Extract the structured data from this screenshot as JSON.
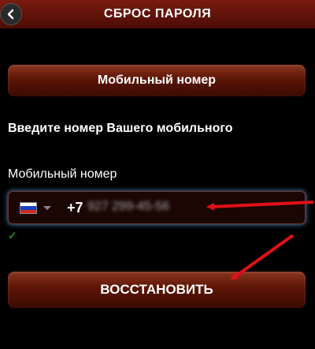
{
  "header": {
    "title": "СБРОС ПАРОЛЯ",
    "back_icon": "chevron-left-icon",
    "background": "#6a150c"
  },
  "tab": {
    "label": "Мобильный номер"
  },
  "form": {
    "heading": "Введите номер Вашего мобильного",
    "field_label": "Мобильный номер",
    "country_icon": "russia-flag-icon",
    "prefix": "+7",
    "phone_value": "927 299-45-56",
    "validation_icon": "checkmark-icon",
    "validation_glyph": "✓",
    "validation_color": "#2fa82f"
  },
  "submit": {
    "label": "ВОССТАНОВИТЬ"
  },
  "annotations": {
    "arrow_color": "#e0101a"
  }
}
